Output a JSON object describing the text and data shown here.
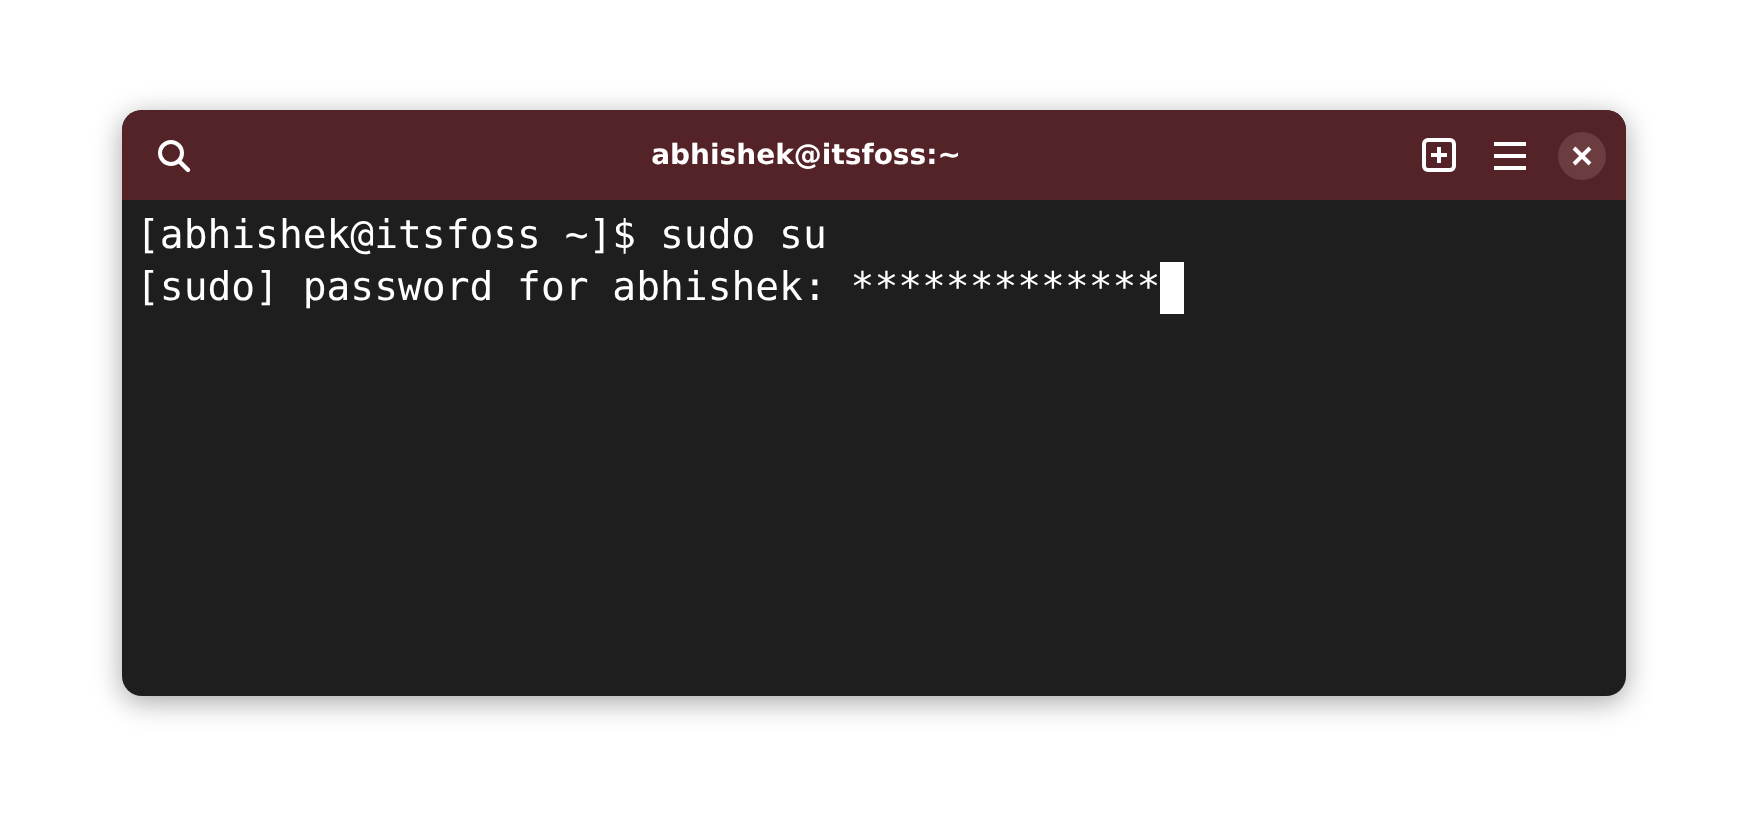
{
  "window": {
    "title": "abhishek@itsfoss:~"
  },
  "terminal": {
    "lines": [
      "[abhishek@itsfoss ~]$ sudo su",
      "[sudo] password for abhishek: *************"
    ]
  }
}
